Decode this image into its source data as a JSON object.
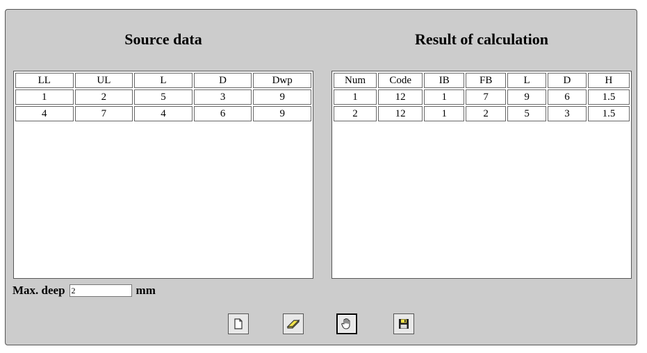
{
  "source": {
    "title": "Source data",
    "headers": [
      "LL",
      "UL",
      "L",
      "D",
      "Dwp"
    ],
    "rows": [
      [
        "1",
        "2",
        "5",
        "3",
        "9"
      ],
      [
        "4",
        "7",
        "4",
        "6",
        "9"
      ]
    ]
  },
  "result": {
    "title": "Result of calculation",
    "headers": [
      "Num",
      "Code",
      "IB",
      "FB",
      "L",
      "D",
      "H"
    ],
    "rows": [
      [
        "1",
        "12",
        "1",
        "7",
        "9",
        "6",
        "1.5"
      ],
      [
        "2",
        "12",
        "1",
        "2",
        "5",
        "3",
        "1.5"
      ]
    ]
  },
  "deep": {
    "label": "Max. deep",
    "value": "2",
    "unit": "mm"
  },
  "toolbar": {
    "buttons": [
      {
        "icon": "new-document-icon"
      },
      {
        "icon": "eraser-icon"
      },
      {
        "icon": "hand-icon",
        "active": true
      },
      {
        "icon": "save-disk-icon"
      }
    ]
  }
}
